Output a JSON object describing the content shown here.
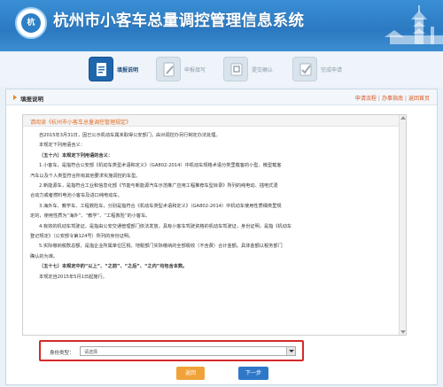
{
  "header": {
    "title": "杭州市小客车总量调控管理信息系统",
    "logo_text": "杭"
  },
  "steps": [
    {
      "label": "填报说明",
      "icon": "document-icon",
      "active": true
    },
    {
      "label": "申报填写",
      "icon": "edit-icon",
      "active": false
    },
    {
      "label": "提交确认",
      "icon": "submit-icon",
      "active": false
    },
    {
      "label": "完成申请",
      "icon": "check-icon",
      "active": false
    }
  ],
  "panel": {
    "title": "填报说明",
    "links": [
      "申请流程",
      "办事指南",
      "返回首页"
    ]
  },
  "content": {
    "banner": "请阅读《杭州市小客车总量调控管理规定》",
    "lines": [
      {
        "text": "自2015年3月31日，因已公示机动车属未取得公安部门，由对调控办另行制定办法处理。",
        "style": "indent"
      },
      {
        "text": "本规定下列用语含义：",
        "style": "indent"
      },
      {
        "text": "（五十六）本规定下列用语的含义：",
        "style": "bold"
      },
      {
        "text": "1.小客车，是指符合公安部《机动车类型术语和定义》（GA802-2014）中机动车规格术语分类里载客的小型、微型载客",
        "style": "indent"
      },
      {
        "text": "汽车以及个人类型符合所有其他要求实施调控的车型。",
        "style": ""
      },
      {
        "text": "2.新能源车，是指符合工业和信息化部《节能与新能源汽车示范推广应用工程推荐车型目录》所列的纯电动、插电式混",
        "style": "indent"
      },
      {
        "text": "合动力或者燃料电池小客车及进口纯电动车。",
        "style": ""
      },
      {
        "text": "3.海外车、教学车、工程救险车，分别是指符合《机动车类型术语和定义》（GA802-2014）中机动车使用性质细类里规",
        "style": "indent"
      },
      {
        "text": "定的，使用性质为“海外”、“教学”、“工程救险”的小客车。",
        "style": ""
      },
      {
        "text": "4.有效的机动车驾驶证，是指由公安交通管理部门依法发放，具有小客车驾驶资格的机动车驾驶证，身份证明，是指《机动车",
        "style": "indent"
      },
      {
        "text": "登记规定》（公安部令第124号）所列的身份证明。",
        "style": ""
      },
      {
        "text": "5.实际缴纳税款总额，是指企业所属单位区税、地税部门实际缴纳的全部税收（不含费）合计金额。具体金额以税务部门",
        "style": "indent"
      },
      {
        "text": "确认的为准。",
        "style": ""
      },
      {
        "text": "（五十七）本规定中的“以上”、“之前”、“之后”、“之内”均包含本数。",
        "style": "bold"
      },
      {
        "text": "本规定自2015年5月1日起施行。",
        "style": "indent"
      }
    ]
  },
  "id_type": {
    "label": "身份类型：",
    "selected": "请选择"
  },
  "buttons": {
    "back": "返回",
    "next": "下一步"
  },
  "colors": {
    "header_blue": "#2b79c2",
    "step_active": "#1f66ad",
    "link_orange": "#d9541e",
    "highlight_red": "#d42a2a",
    "back_button": "#f0a23a",
    "next_button": "#2f78c8"
  }
}
